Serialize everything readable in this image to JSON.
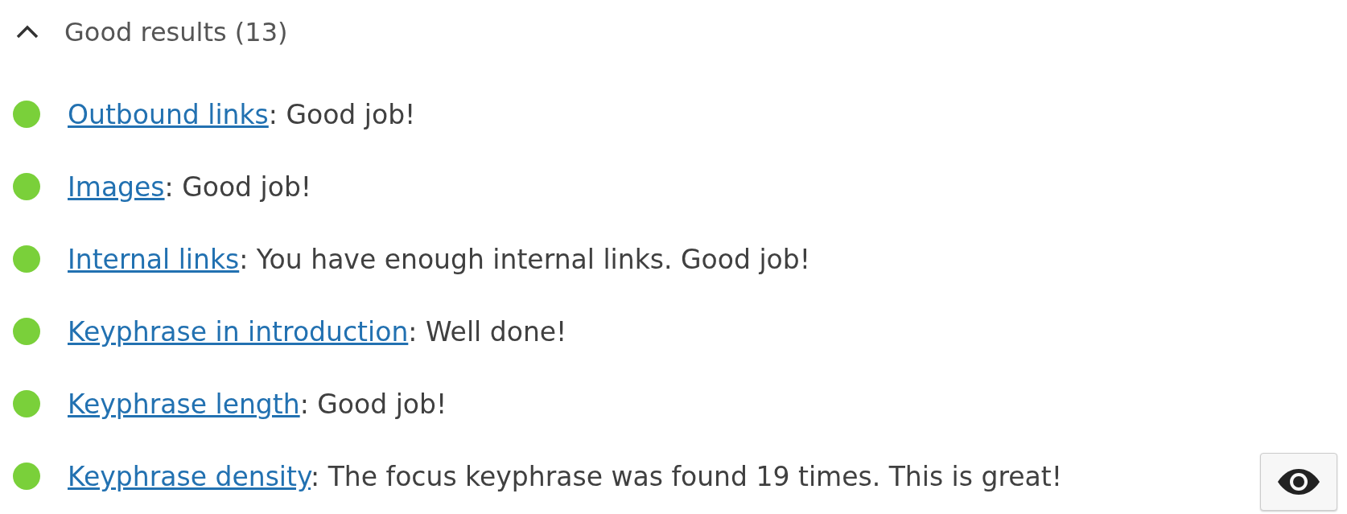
{
  "section": {
    "title": "Good results (13)",
    "expanded": true
  },
  "results": [
    {
      "color": "#7ad03a",
      "link": "Outbound links",
      "text": ": Good job!"
    },
    {
      "color": "#7ad03a",
      "link": "Images",
      "text": ": Good job!"
    },
    {
      "color": "#7ad03a",
      "link": "Internal links",
      "text": ": You have enough internal links. Good job!"
    },
    {
      "color": "#7ad03a",
      "link": "Keyphrase in introduction",
      "text": ": Well done!"
    },
    {
      "color": "#7ad03a",
      "link": "Keyphrase length",
      "text": ": Good job!"
    },
    {
      "color": "#7ad03a",
      "link": "Keyphrase density",
      "text": ": The focus keyphrase was found 19 times. This is great!"
    }
  ]
}
